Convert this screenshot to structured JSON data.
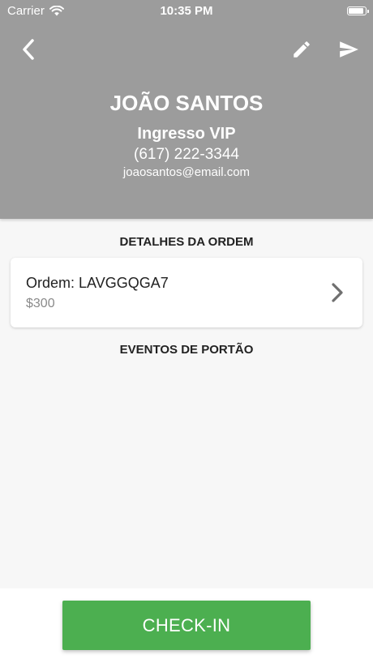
{
  "status_bar": {
    "carrier": "Carrier",
    "time": "10:35 PM"
  },
  "header": {
    "back_icon": "chevron-left-icon",
    "edit_icon": "pencil-icon",
    "send_icon": "send-icon",
    "name": "JOÃO SANTOS",
    "ticket_type": "Ingresso VIP",
    "phone": "(617) 222-3344",
    "email": "joaosantos@email.com"
  },
  "order_section": {
    "title": "DETALHES DA ORDEM",
    "order_label": "Ordem: LAVGGQGA7",
    "amount": "$300"
  },
  "gate_section": {
    "title": "EVENTOS DE PORTÃO"
  },
  "actions": {
    "checkin_label": "CHECK-IN"
  },
  "colors": {
    "header_bg": "#9c9c9c",
    "page_bg": "#f7f7f7",
    "checkin_bg": "#4caf50"
  }
}
